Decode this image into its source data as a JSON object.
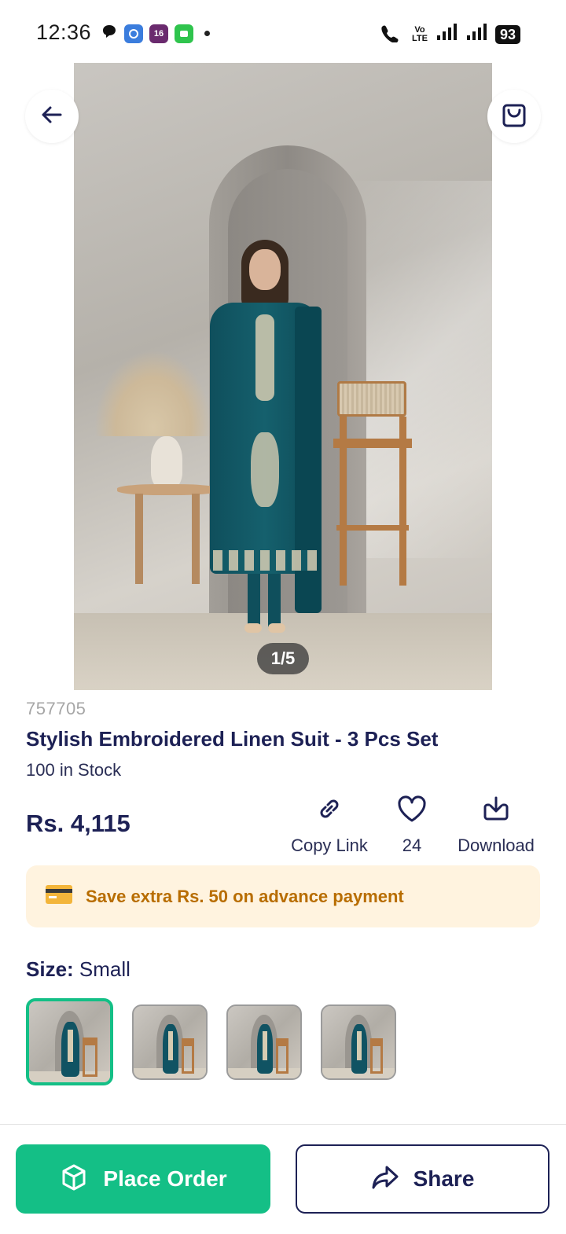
{
  "status_bar": {
    "time": "12:36",
    "badge_16": "16",
    "lte_line1": "Vo",
    "lte_line2": "LTE",
    "battery": "93"
  },
  "hero": {
    "image_counter": "1/5"
  },
  "product": {
    "sku": "757705",
    "title": "Stylish Embroidered Linen Suit - 3 Pcs Set",
    "stock": "100 in Stock",
    "price": "Rs. 4,115"
  },
  "actions": {
    "copy_link": "Copy Link",
    "likes": "24",
    "download": "Download"
  },
  "promo": {
    "text": "Save extra Rs. 50 on advance payment"
  },
  "size": {
    "label": "Size:",
    "value": "Small",
    "selected_index": 0
  },
  "bottom_bar": {
    "place_order": "Place Order",
    "share": "Share"
  },
  "colors": {
    "primary_green": "#14bf86",
    "navy_text": "#1d2155",
    "promo_bg": "#fff3df",
    "promo_text": "#b86d00"
  },
  "icons": [
    "back-arrow-icon",
    "shopping-bag-icon",
    "link-icon",
    "heart-icon",
    "download-icon",
    "credit-card-icon",
    "box-icon",
    "share-icon"
  ]
}
